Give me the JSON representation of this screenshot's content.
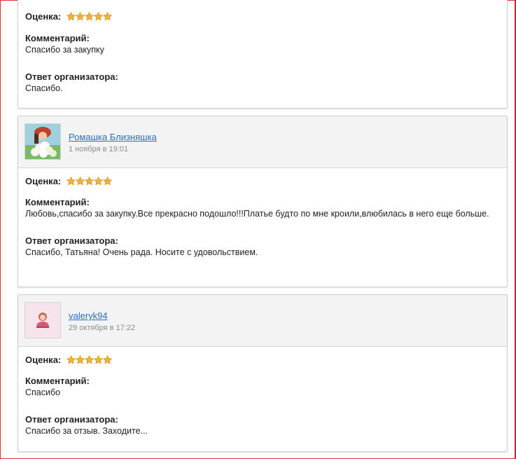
{
  "labels": {
    "rating": "Оценка:",
    "comment": "Комментарий:",
    "answer": "Ответ организатора:"
  },
  "star_color": "#f0a820",
  "reviews": [
    {
      "rating": 5,
      "comment": "Спасибо за закупку",
      "answer": "Спасибо."
    },
    {
      "author": "Ромашка Близняшка",
      "date": "1 ноября в 19:01",
      "avatar_icon": "woman-with-flowers-photo",
      "rating": 5,
      "comment": "Любовь,спасибо за закупку.Все прекрасно подошло!!!Платье будто по мне кроили,влюбилась в него еще больше.",
      "answer": "Спасибо, Татьяна! Очень рада. Носите с удовольствием."
    },
    {
      "author": "valeryk94",
      "date": "29 октября в 17:22",
      "avatar_icon": "default-user-icon",
      "rating": 5,
      "comment": "Спасибо",
      "answer": "Спасибо за отзыв. Заходите..."
    }
  ]
}
